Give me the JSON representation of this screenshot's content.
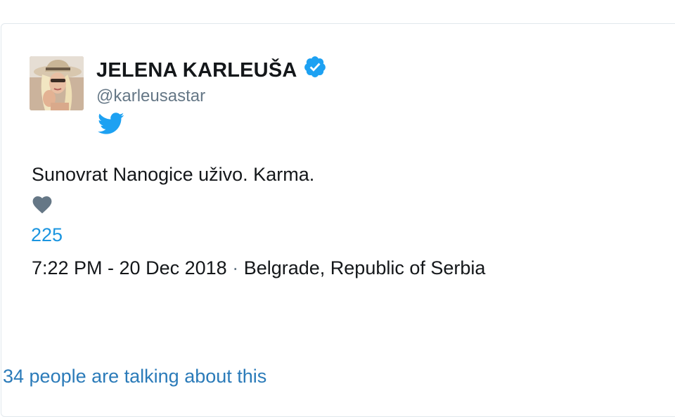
{
  "tweet": {
    "author": {
      "display_name": "JELENA KARLEUŠA",
      "handle": "@karleusastar",
      "verified": true,
      "avatar_icon": "profile-photo"
    },
    "text": "Sunovrat Nanogice uživo. Karma.",
    "like_count": "225",
    "timestamp": "7:22 PM - 20 Dec 2018",
    "separator": "·",
    "location": "Belgrade, Republic of Serbia",
    "talking": "34 people are talking about this"
  },
  "colors": {
    "brand_blue": "#1da1f2",
    "link_blue": "#1b95e0",
    "heart_gray": "#657786",
    "text_dark": "#14171a"
  }
}
